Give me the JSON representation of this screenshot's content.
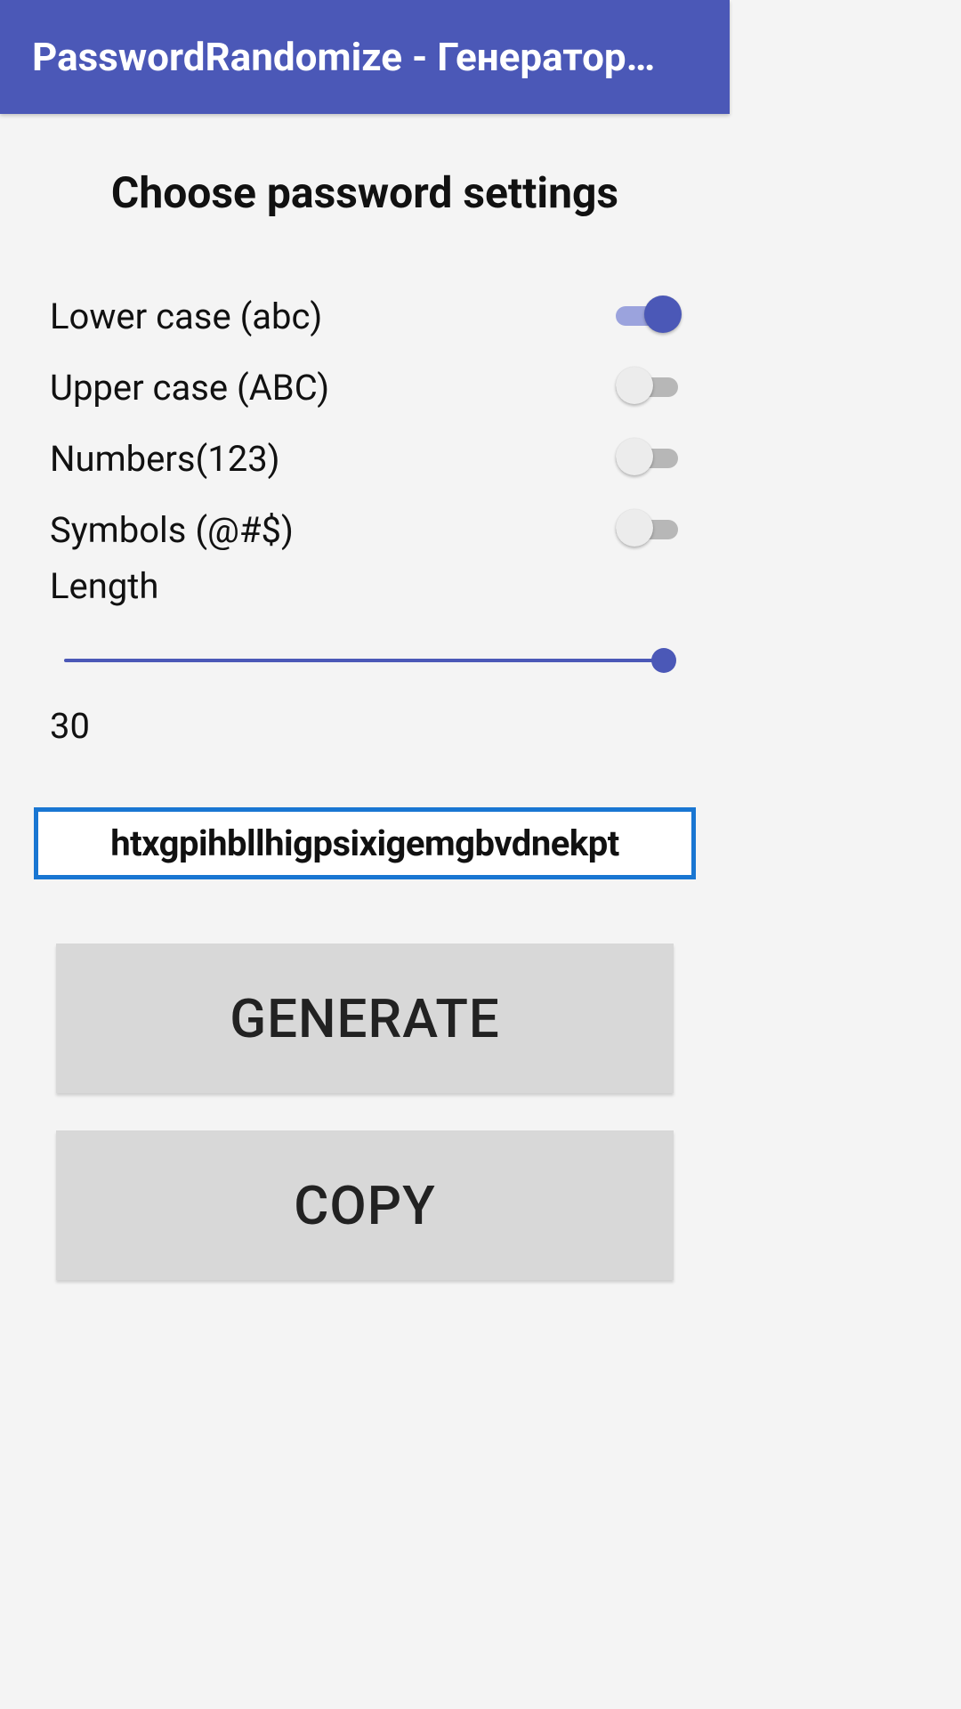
{
  "appbar": {
    "title": "PasswordRandomize - Генератор…"
  },
  "heading": "Choose password settings",
  "settings": {
    "lower": {
      "label": "Lower case (abc)",
      "on": true
    },
    "upper": {
      "label": "Upper case (ABC)",
      "on": false
    },
    "numbers": {
      "label": "Numbers(123)",
      "on": false
    },
    "symbols": {
      "label": "Symbols (@#$)",
      "on": false
    }
  },
  "length": {
    "label": "Length",
    "value": "30"
  },
  "password": "htxgpihbllhigpsixigemgbvdnekpt",
  "buttons": {
    "generate": "GENERATE",
    "copy": "COPY"
  }
}
